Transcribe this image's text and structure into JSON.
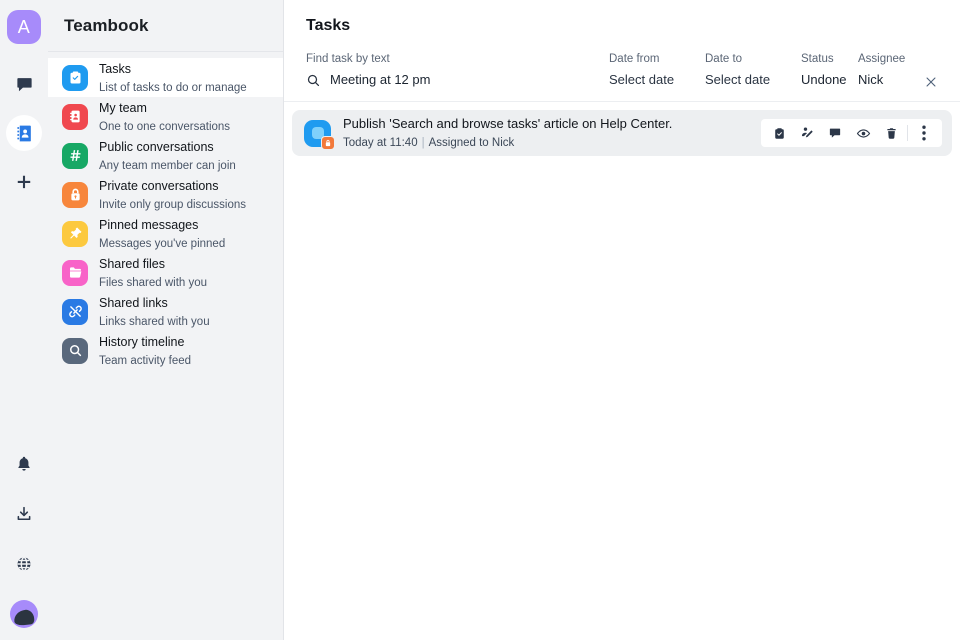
{
  "rail": {
    "avatar_initial": "A",
    "items": [
      {
        "name": "chat-icon",
        "label": "Chat",
        "active": false
      },
      {
        "name": "contacts-icon",
        "label": "Contacts",
        "active": true
      },
      {
        "name": "plus-icon",
        "label": "Add",
        "active": false
      }
    ],
    "bottom_items": [
      {
        "name": "bell-icon",
        "label": "Notifications"
      },
      {
        "name": "download-icon",
        "label": "Downloads"
      },
      {
        "name": "globe-icon",
        "label": "Help"
      },
      {
        "name": "app-logo",
        "label": "Bitrix logo"
      }
    ]
  },
  "sidebar": {
    "title": "Teambook",
    "items": [
      {
        "title": "Tasks",
        "subtitle": "List of tasks to do or manage",
        "icon": "clipboard-check-icon",
        "color": "#1f9bf0",
        "selected": true
      },
      {
        "title": "My team",
        "subtitle": "One to one conversations",
        "icon": "address-book-icon",
        "color": "#f0484f",
        "selected": false
      },
      {
        "title": "Public conversations",
        "subtitle": "Any team member can join",
        "icon": "hash-icon",
        "color": "#17a865",
        "selected": false
      },
      {
        "title": "Private conversations",
        "subtitle": "Invite only group discussions",
        "icon": "lock-icon",
        "color": "#f7863c",
        "selected": false
      },
      {
        "title": "Pinned messages",
        "subtitle": "Messages you've pinned",
        "icon": "pin-icon",
        "color": "#fcc93f",
        "selected": false
      },
      {
        "title": "Shared files",
        "subtitle": "Files shared with you",
        "icon": "folder-icon",
        "color": "#f863c8",
        "selected": false
      },
      {
        "title": "Shared links",
        "subtitle": "Links shared with you",
        "icon": "link-icon",
        "color": "#2a7ae4",
        "selected": false
      },
      {
        "title": "History timeline",
        "subtitle": "Team activity feed",
        "icon": "search-icon",
        "color": "#59687c",
        "selected": false
      }
    ]
  },
  "main": {
    "title": "Tasks",
    "filters": {
      "search_label": "Find task by text",
      "search_value": "Meeting at 12 pm",
      "search_placeholder": "Find task by text",
      "date_from_label": "Date from",
      "date_from_value": "Select date",
      "date_to_label": "Date to",
      "date_to_value": "Select date",
      "status_label": "Status",
      "status_value": "Undone",
      "assignee_label": "Assignee",
      "assignee_value": "Nick",
      "clear_label": "Clear filters"
    },
    "tasks": [
      {
        "title": "Publish 'Search and browse tasks' article on Help Center.",
        "date": "Today at 11:40",
        "separator": "|",
        "assignee": "Assigned to Nick",
        "actions": [
          {
            "name": "complete-task-icon",
            "label": "Complete"
          },
          {
            "name": "reassign-task-icon",
            "label": "Reassign"
          },
          {
            "name": "comment-icon",
            "label": "Comment"
          },
          {
            "name": "watch-icon",
            "label": "Watch"
          },
          {
            "name": "delete-icon",
            "label": "Delete"
          },
          {
            "name": "more-options-icon",
            "label": "More"
          }
        ]
      }
    ]
  },
  "colors": {
    "accent": "#1f9bf0",
    "rail_bg": "#f2f3f5",
    "sidebar_bg": "#f2f3f5",
    "task_row_bg": "#edeff1",
    "avatar_bg": "#a78bfa"
  }
}
